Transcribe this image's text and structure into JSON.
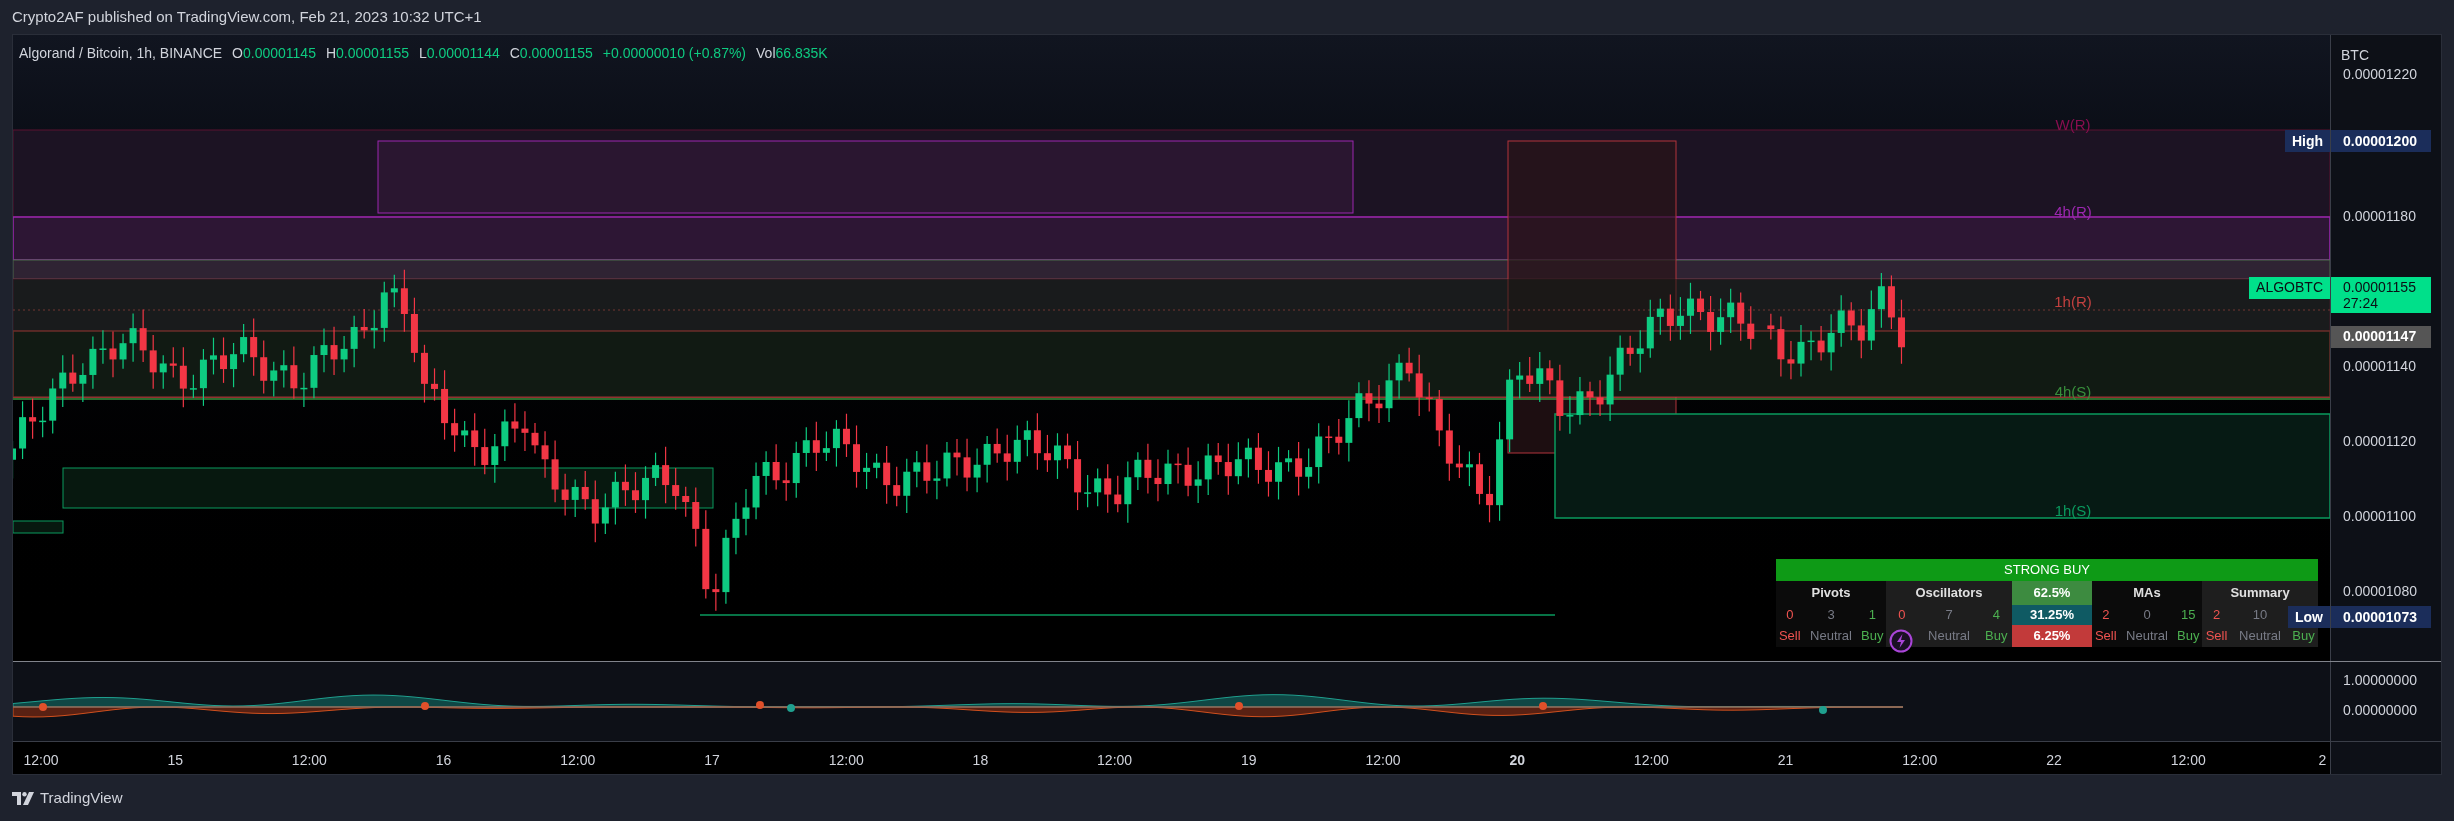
{
  "publish_note": "Crypto2AF published on TradingView.com, Feb 21, 2023 10:32 UTC+1",
  "legend": {
    "symbol": "Algorand / Bitcoin, 1h, BINANCE",
    "ohlc": [
      {
        "label": "O",
        "value": "0.00001145"
      },
      {
        "label": "H",
        "value": "0.00001155"
      },
      {
        "label": "L",
        "value": "0.00001144"
      },
      {
        "label": "C",
        "value": "0.00001155"
      }
    ],
    "change": "+0.00000010 (+0.87%)",
    "volume": {
      "label": "Vol",
      "value": "66.835K"
    }
  },
  "levels": [
    {
      "label": "W(R)",
      "color": "#880e4f"
    },
    {
      "label": "4h(R)",
      "color": "#9c27b0"
    },
    {
      "label": "1h(R)",
      "color": "#c2403f"
    },
    {
      "label": "4h(S)",
      "color": "#388e3c"
    },
    {
      "label": "1h(S)",
      "color": "#0a9a5e"
    }
  ],
  "price_axis": {
    "unit": "BTC",
    "labels": [
      "0.00001220",
      "0.00001180",
      "0.00001140",
      "0.00001120",
      "0.00001100",
      "0.00001080"
    ]
  },
  "price_tags": [
    {
      "kind": "extreme",
      "label": "High",
      "value": "0.00001200"
    },
    {
      "kind": "last",
      "label": "ALGOBTC",
      "value": "0.00001155",
      "countdown": "27:24"
    },
    {
      "kind": "prev",
      "value": "0.00001147"
    },
    {
      "kind": "extreme",
      "label": "Low",
      "value": "0.00001073"
    }
  ],
  "indicator_axis": [
    "1.00000000",
    "0.00000000"
  ],
  "time_axis": [
    {
      "label": "12:00",
      "major": false
    },
    {
      "label": "15",
      "major": false
    },
    {
      "label": "12:00",
      "major": false
    },
    {
      "label": "16",
      "major": false
    },
    {
      "label": "12:00",
      "major": false
    },
    {
      "label": "17",
      "major": false
    },
    {
      "label": "12:00",
      "major": false
    },
    {
      "label": "18",
      "major": false
    },
    {
      "label": "12:00",
      "major": false
    },
    {
      "label": "19",
      "major": false
    },
    {
      "label": "12:00",
      "major": false
    },
    {
      "label": "20",
      "major": true
    },
    {
      "label": "12:00",
      "major": false
    },
    {
      "label": "21",
      "major": false
    },
    {
      "label": "12:00",
      "major": false
    },
    {
      "label": "22",
      "major": false
    },
    {
      "label": "12:00",
      "major": false
    },
    {
      "label": "2",
      "major": false
    }
  ],
  "signal_table": {
    "title": "STRONG BUY",
    "groups": [
      {
        "title": "Pivots",
        "cells": [
          {
            "kind": "sell",
            "count": "0",
            "label": "Sell"
          },
          {
            "kind": "neutral",
            "count": "3",
            "label": "Neutral"
          },
          {
            "kind": "buy",
            "count": "1",
            "label": "Buy"
          }
        ]
      },
      {
        "title": "Oscillators",
        "cells": [
          {
            "kind": "sell",
            "count": "0"
          },
          {
            "kind": "neutral",
            "count": "7",
            "label": "Neutral"
          },
          {
            "kind": "buy",
            "count": "4",
            "label": "Buy"
          }
        ]
      },
      {
        "title": "MAs",
        "cells": [
          {
            "kind": "sell",
            "count": "2",
            "label": "Sell"
          },
          {
            "kind": "neutral",
            "count": "0",
            "label": "Neutral"
          },
          {
            "kind": "buy",
            "count": "15",
            "label": "Buy"
          }
        ]
      },
      {
        "title": "Summary",
        "cells": [
          {
            "kind": "sell",
            "count": "2",
            "label": "Sell"
          },
          {
            "kind": "neutral",
            "count": "10",
            "label": "Neutral"
          },
          {
            "kind": "buy",
            "label": "Buy"
          }
        ]
      }
    ],
    "percents": [
      {
        "value": "62.5%",
        "color": "#3d8b40"
      },
      {
        "value": "31.25%",
        "color": "#0f5a63"
      },
      {
        "value": "6.25%",
        "color": "#c23a3a"
      }
    ]
  },
  "footer": {
    "brand": "TradingView"
  }
}
